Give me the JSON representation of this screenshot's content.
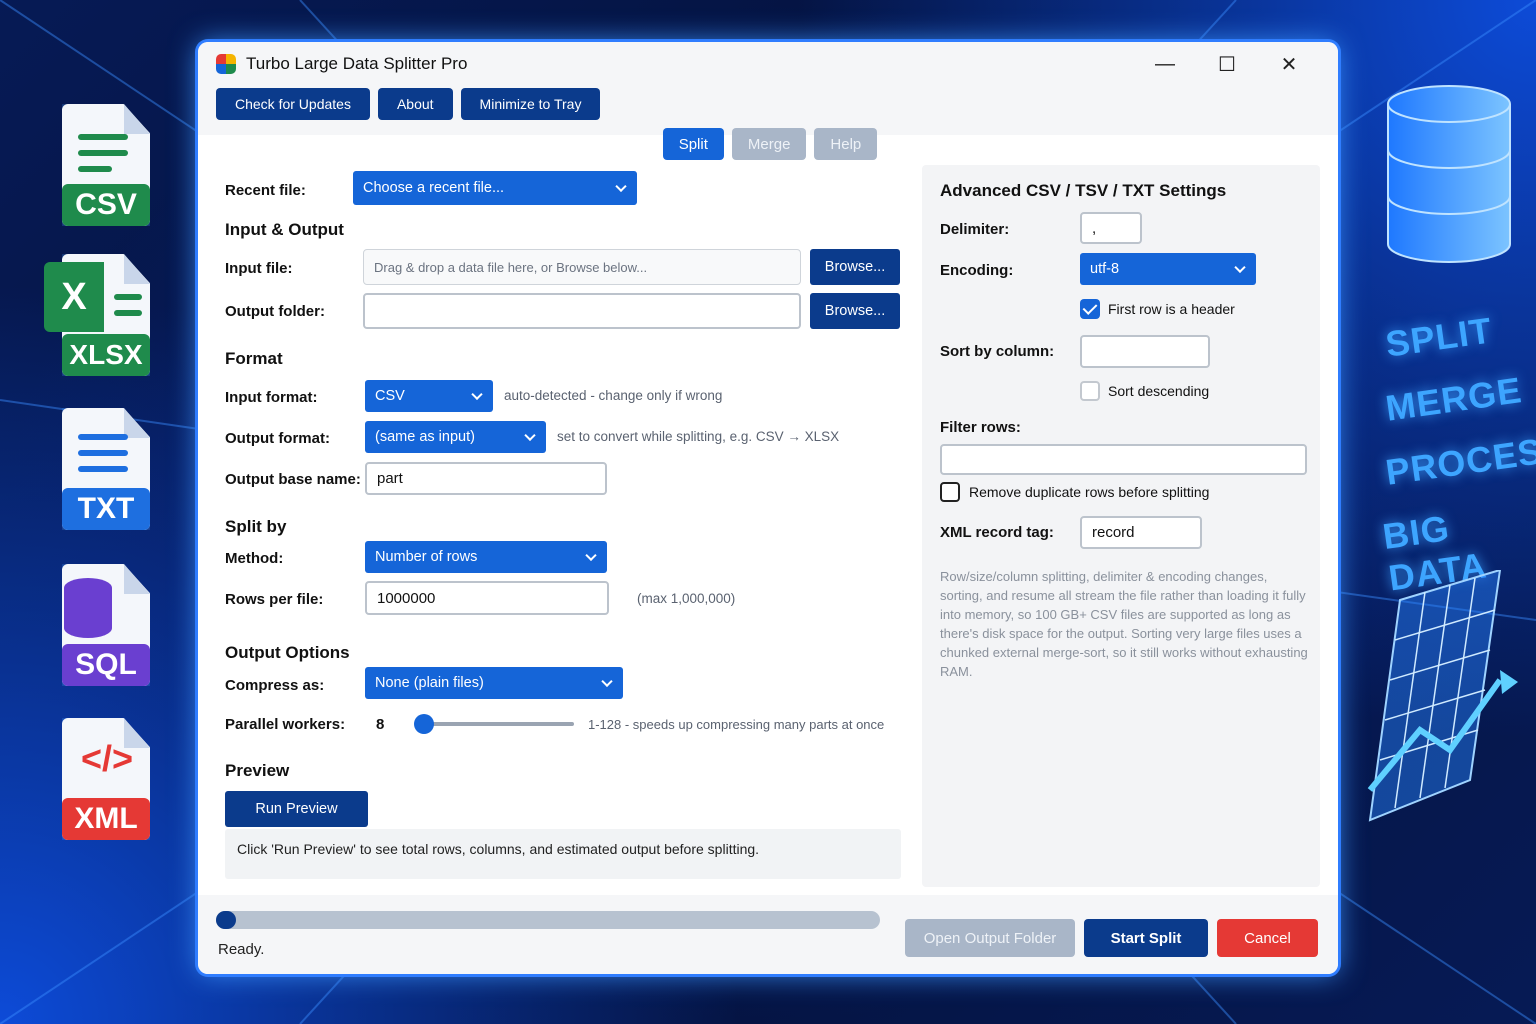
{
  "left_icons": [
    {
      "name": "csv-file-icon",
      "label": "CSV",
      "color": "#1f8b4c"
    },
    {
      "name": "xlsx-file-icon",
      "label": "XLSX",
      "color": "#1f8b4c",
      "letter": "X"
    },
    {
      "name": "txt-file-icon",
      "label": "TXT",
      "color": "#1e6fe0"
    },
    {
      "name": "sql-file-icon",
      "label": "SQL",
      "color": "#6a3fd0"
    },
    {
      "name": "xml-file-icon",
      "label": "XML",
      "color": "#e53935",
      "glyph": "</>"
    }
  ],
  "side_words": [
    "SPLIT",
    "MERGE",
    "PROCESS",
    "BIG DATA"
  ],
  "window": {
    "title": "Turbo Large Data Splitter Pro",
    "controls": {
      "minimize": "—",
      "maximize": "☐",
      "close": "✕"
    }
  },
  "toolbar": {
    "updates": "Check for Updates",
    "about": "About",
    "tray": "Minimize to Tray"
  },
  "tabs": {
    "split": "Split",
    "merge": "Merge",
    "help": "Help"
  },
  "recent": {
    "label": "Recent file:",
    "value": "Choose a recent file..."
  },
  "io": {
    "header": "Input & Output",
    "input_label": "Input file:",
    "input_placeholder": "Drag & drop a data file here, or Browse below...",
    "browse": "Browse...",
    "output_label": "Output folder:",
    "output_value": ""
  },
  "format": {
    "header": "Format",
    "input_label": "Input format:",
    "input_value": "CSV",
    "input_note": "auto-detected - change only if wrong",
    "output_label": "Output format:",
    "output_value": "(same as input)",
    "output_note": "set to convert while splitting, e.g. CSV → XLSX",
    "base_label": "Output base name:",
    "base_value": "part"
  },
  "split": {
    "header": "Split by",
    "method_label": "Method:",
    "method_value": "Number of rows",
    "rows_label": "Rows per file:",
    "rows_value": "1000000",
    "rows_note": "(max 1,000,000)"
  },
  "options": {
    "header": "Output Options",
    "compress_label": "Compress as:",
    "compress_value": "None (plain files)",
    "workers_label": "Parallel workers:",
    "workers_value": "8",
    "workers_level": 0.05,
    "workers_note": "1-128 - speeds up compressing many parts at once"
  },
  "preview": {
    "header": "Preview",
    "button": "Run Preview",
    "text": "Click 'Run Preview' to see total rows, columns, and estimated output before splitting."
  },
  "advanced": {
    "header": "Advanced CSV / TSV / TXT Settings",
    "delimiter_label": "Delimiter:",
    "delimiter_value": ",",
    "encoding_label": "Encoding:",
    "encoding_value": "utf-8",
    "header_row_label": "First row is a header",
    "header_row_checked": true,
    "sort_label": "Sort by column:",
    "sort_value": "",
    "sort_desc_label": "Sort descending",
    "sort_desc_checked": false,
    "filter_label": "Filter rows:",
    "filter_value": "",
    "dedupe_label": "Remove duplicate rows before splitting",
    "dedupe_checked": false,
    "xml_label": "XML record tag:",
    "xml_value": "record",
    "info": "Row/size/column splitting, delimiter & encoding changes, sorting, and resume all stream the file rather than loading it fully into memory, so 100 GB+ CSV files are supported as long as there's disk space for the output. Sorting very large files uses a chunked external merge-sort, so it still works without exhausting RAM."
  },
  "footer": {
    "progress": 0.0,
    "status": "Ready.",
    "open_folder": "Open Output Folder",
    "start": "Start Split",
    "cancel": "Cancel"
  },
  "colors": {
    "primary": "#1565d8",
    "dark": "#0b3b8c",
    "cancel": "#e53935",
    "disabled": "#a9b6c8"
  }
}
